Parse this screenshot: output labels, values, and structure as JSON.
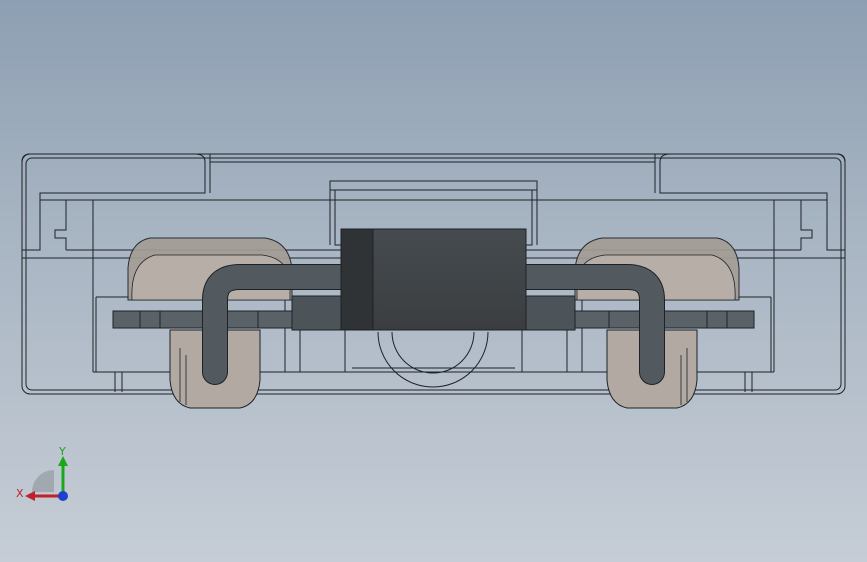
{
  "viewport": {
    "background_top": "#8d9fb2",
    "background_bottom": "#c6cdd6",
    "model": {
      "edge_color": "#1d2228",
      "body_fill": "#7e8b99",
      "pad_color": "#b5aca3",
      "lead_color": "#4c5459",
      "component_color": "#3f4448"
    }
  },
  "triad": {
    "x_label": "X",
    "y_label": "Y",
    "x_color": "#c0202a",
    "y_color": "#1aa81a",
    "z_color": "#1f3fd0",
    "icon": "coordinate-triad-icon"
  }
}
